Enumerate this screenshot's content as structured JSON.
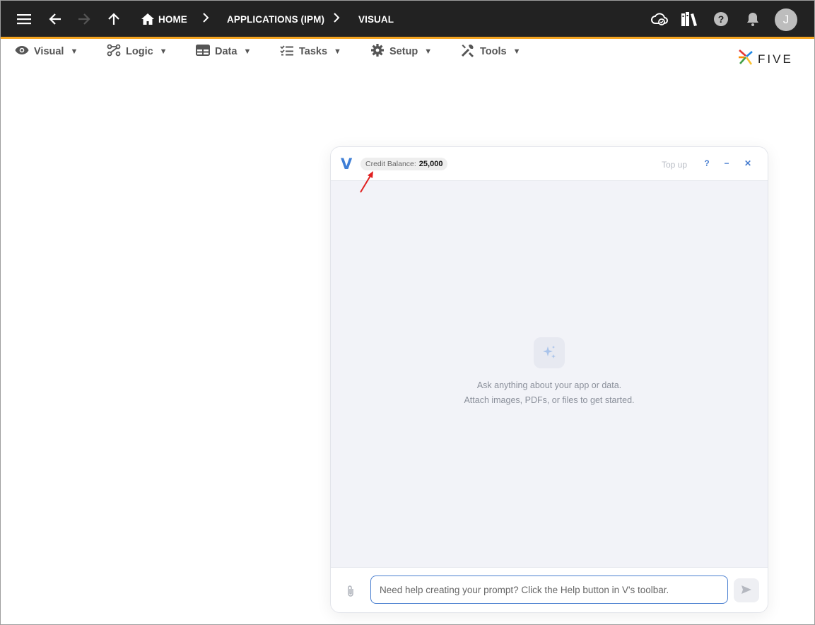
{
  "appbar": {
    "breadcrumbs": [
      "HOME",
      "APPLICATIONS (IPM)",
      "VISUAL"
    ],
    "avatar_initial": "J",
    "accent_color": "#f5a623",
    "icons": [
      "menu-icon",
      "back-arrow-icon",
      "forward-arrow-icon",
      "up-arrow-icon",
      "home-icon",
      "cloud-check-icon",
      "library-icon",
      "help-icon",
      "bell-icon"
    ]
  },
  "menu": {
    "items": [
      {
        "label": "Visual",
        "icon": "eye-icon"
      },
      {
        "label": "Logic",
        "icon": "logic-icon"
      },
      {
        "label": "Data",
        "icon": "table-icon"
      },
      {
        "label": "Tasks",
        "icon": "checklist-icon"
      },
      {
        "label": "Setup",
        "icon": "gear-icon"
      },
      {
        "label": "Tools",
        "icon": "tools-icon"
      }
    ],
    "caret": "▼"
  },
  "brand": {
    "logo_text": "FIVE"
  },
  "chat": {
    "v_logo": "V",
    "credit_label": "Credit Balance:",
    "credit_value": "25,000",
    "topup_label": "Top up",
    "help_label": "?",
    "minimize_label": "−",
    "close_label": "✕",
    "empty_line1": "Ask anything about your app or data.",
    "empty_line2": "Attach images, PDFs, or files to get started.",
    "input_placeholder": "Need help creating your prompt? Click the Help button in V's toolbar.",
    "accent_color": "#4a7fd0"
  }
}
